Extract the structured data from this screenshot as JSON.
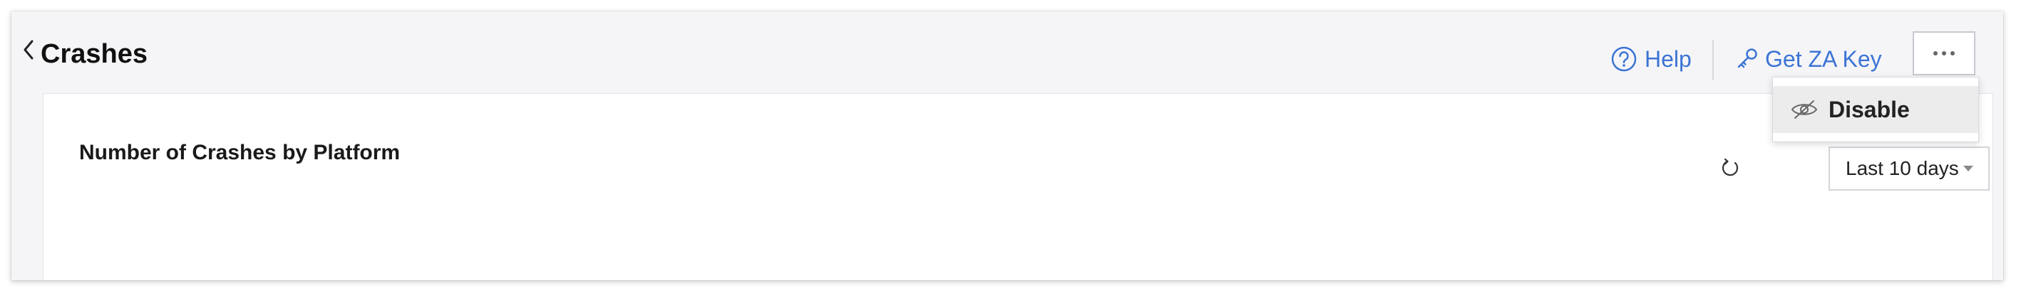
{
  "header": {
    "title": "Crashes",
    "back_icon": "chevron-left-icon",
    "help_label": "Help",
    "help_icon": "help-circle-icon",
    "key_label": "Get ZA Key",
    "key_icon": "key-icon",
    "more_icon": "more-horizontal-icon"
  },
  "menu": {
    "items": [
      {
        "label": "Disable",
        "icon": "eye-off-icon"
      }
    ]
  },
  "card": {
    "title": "Number of Crashes by Platform",
    "refresh_icon": "refresh-icon",
    "range_selected": "Last 10 days"
  },
  "colors": {
    "link": "#3c74d4",
    "background": "#f5f5f8",
    "card": "#ffffff"
  }
}
